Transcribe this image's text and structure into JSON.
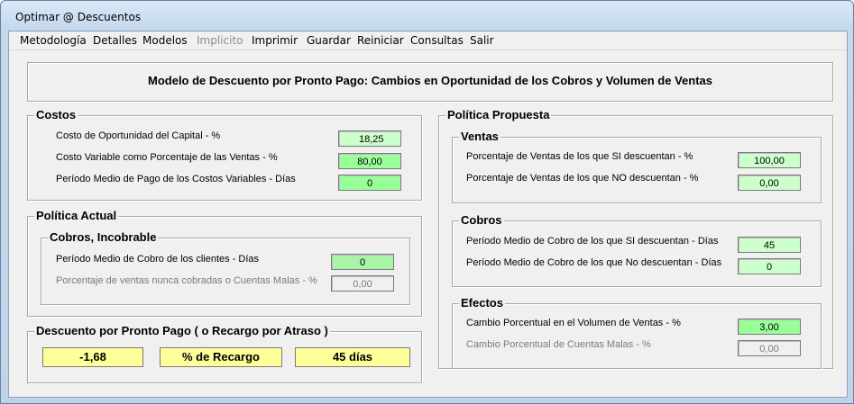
{
  "window": {
    "title": "Optimar @ Descuentos"
  },
  "menu": [
    {
      "label": "Metodología",
      "enabled": true
    },
    {
      "label": "Detalles",
      "enabled": true
    },
    {
      "label": "Modelos",
      "enabled": true
    },
    {
      "label": "Implicito",
      "enabled": false
    },
    {
      "label": "Imprimir",
      "enabled": true
    },
    {
      "label": "Guardar",
      "enabled": true
    },
    {
      "label": "Reiniciar",
      "enabled": true
    },
    {
      "label": "Consultas",
      "enabled": true
    },
    {
      "label": "Salir",
      "enabled": true
    }
  ],
  "header": {
    "title": "Modelo de Descuento por Pronto Pago: Cambios en Oportunidad de los Cobros y Volumen de Ventas"
  },
  "costos": {
    "title": "Costos",
    "rows": [
      {
        "label": "Costo de Oportunidad del Capital - %",
        "value": "18,25"
      },
      {
        "label": "Costo Variable como Porcentaje de las Ventas - %",
        "value": "80,00"
      },
      {
        "label": "Período Medio de Pago de los Costos Variables - Días",
        "value": "0"
      }
    ]
  },
  "politica_actual": {
    "title": "Política Actual",
    "cobros": {
      "title": "Cobros, Incobrable",
      "rows": [
        {
          "label": "Período Medio de Cobro de los clientes - Días",
          "value": "0"
        },
        {
          "label": "Porcentaje  de ventas nunca cobradas o Cuentas Malas - %",
          "value": "0,00"
        }
      ]
    }
  },
  "descuento": {
    "title": "Descuento por Pronto Pago ( o Recargo por Atraso )",
    "value": "-1,68",
    "type": "% de Recargo",
    "days": "45 días"
  },
  "politica_propuesta": {
    "title": "Política Propuesta",
    "ventas": {
      "title": "Ventas",
      "rows": [
        {
          "label": "Porcentaje de Ventas de los que SI descuentan - %",
          "value": "100,00"
        },
        {
          "label": "Porcentaje de Ventas de los que NO descuentan - %",
          "value": "0,00"
        }
      ]
    },
    "cobros": {
      "title": "Cobros",
      "rows": [
        {
          "label": "Período Medio de Cobro de los que SI descuentan - Días",
          "value": "45"
        },
        {
          "label": "Período Medio de Cobro de los que No descuentan - Días",
          "value": "0"
        }
      ]
    },
    "efectos": {
      "title": "Efectos",
      "rows": [
        {
          "label": "Cambio Porcentual en el  Volumen de Ventas - %",
          "value": "3,00"
        },
        {
          "label": "Cambio Porcentual de Cuentas Malas - %",
          "value": "0,00"
        }
      ]
    }
  },
  "colors": {
    "field_light_green": "#ccffcc",
    "field_green": "#99ff99",
    "result_yellow": "#ffff99",
    "disabled_text": "#7a7a7a"
  }
}
